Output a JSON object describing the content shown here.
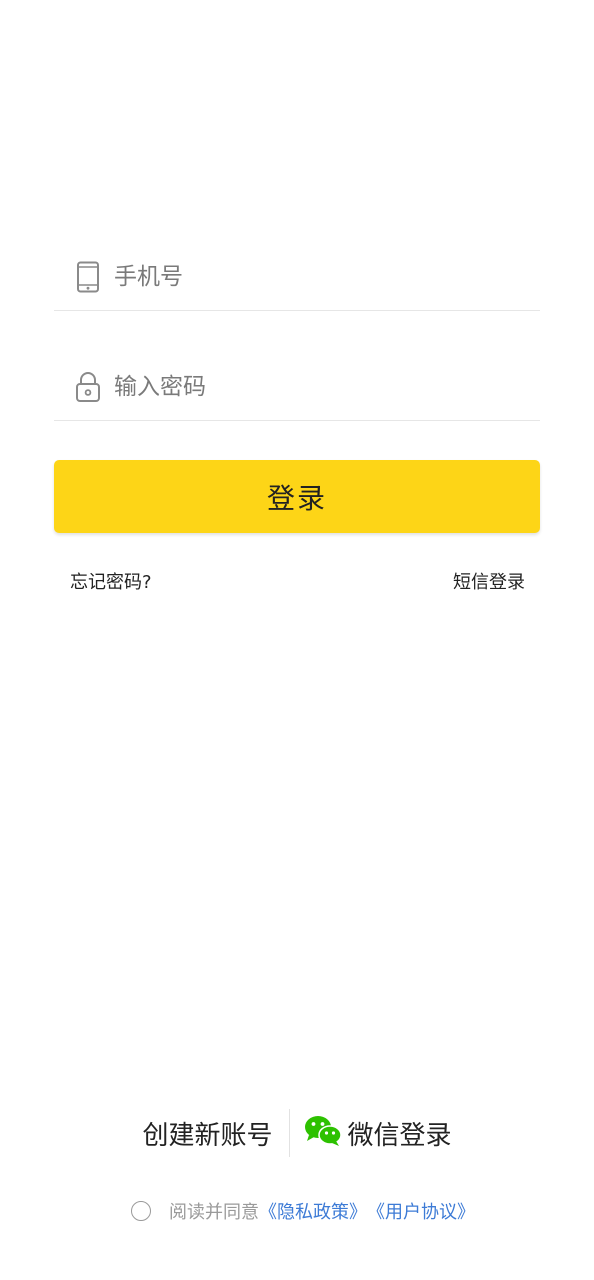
{
  "login_form": {
    "phone_placeholder": "手机号",
    "password_placeholder": "输入密码",
    "phone_icon": "phone-icon",
    "lock_icon": "lock-icon",
    "submit_label": "登录"
  },
  "links": {
    "forgot_password": "忘记密码?",
    "sms_login": "短信登录"
  },
  "bottom": {
    "create_account": "创建新账号",
    "wechat_login": "微信登录",
    "wechat_icon": "wechat-icon"
  },
  "agreement": {
    "prefix": "阅读并同意",
    "privacy_policy": "《隐私政策》",
    "user_agreement": "《用户协议》"
  },
  "colors": {
    "primary_button": "#fdd517",
    "link": "#3d7bd6",
    "wechat_green": "#2dc100"
  }
}
